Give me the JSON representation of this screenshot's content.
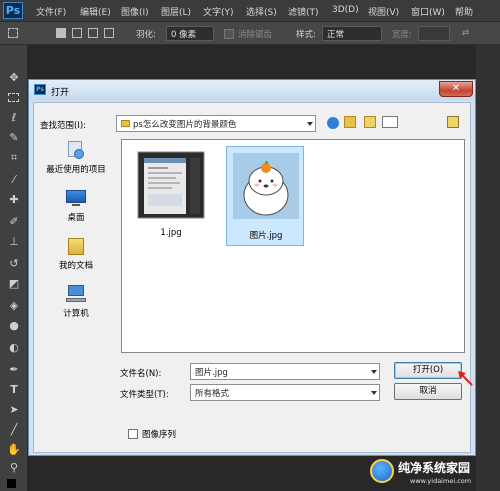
{
  "ps": {
    "logo": "Ps",
    "menus": [
      "文件(F)",
      "编辑(E)",
      "图像(I)",
      "图层(L)",
      "文字(Y)",
      "选择(S)",
      "滤镜(T)",
      "3D(D)",
      "视图(V)",
      "窗口(W)",
      "帮助"
    ],
    "options": {
      "feather_label": "羽化:",
      "feather_value": "0 像素",
      "antialias_label": "消除锯齿",
      "style_label": "样式:",
      "style_value": "正常",
      "width_label": "宽度:"
    }
  },
  "dialog": {
    "title": "打开",
    "close": "✕",
    "lookin_label": "查找范围(I):",
    "lookin_value": "ps怎么改变图片的背景颜色",
    "places": [
      {
        "label": "最近使用的项目",
        "icon": "recent-items-icon"
      },
      {
        "label": "桌面",
        "icon": "desktop-icon"
      },
      {
        "label": "我的文档",
        "icon": "documents-icon"
      },
      {
        "label": "计算机",
        "icon": "computer-icon"
      }
    ],
    "files": [
      {
        "name": "1.jpg"
      },
      {
        "name": "图片.jpg"
      }
    ],
    "filename_label": "文件名(N):",
    "filename_value": "图片.jpg",
    "filetype_label": "文件类型(T):",
    "filetype_value": "所有格式",
    "open_button": "打开(O)",
    "cancel_button": "取消",
    "sequence_label": "图像序列"
  },
  "watermark": {
    "text": "纯净系统家园",
    "url": "www.yidaimei.com"
  }
}
